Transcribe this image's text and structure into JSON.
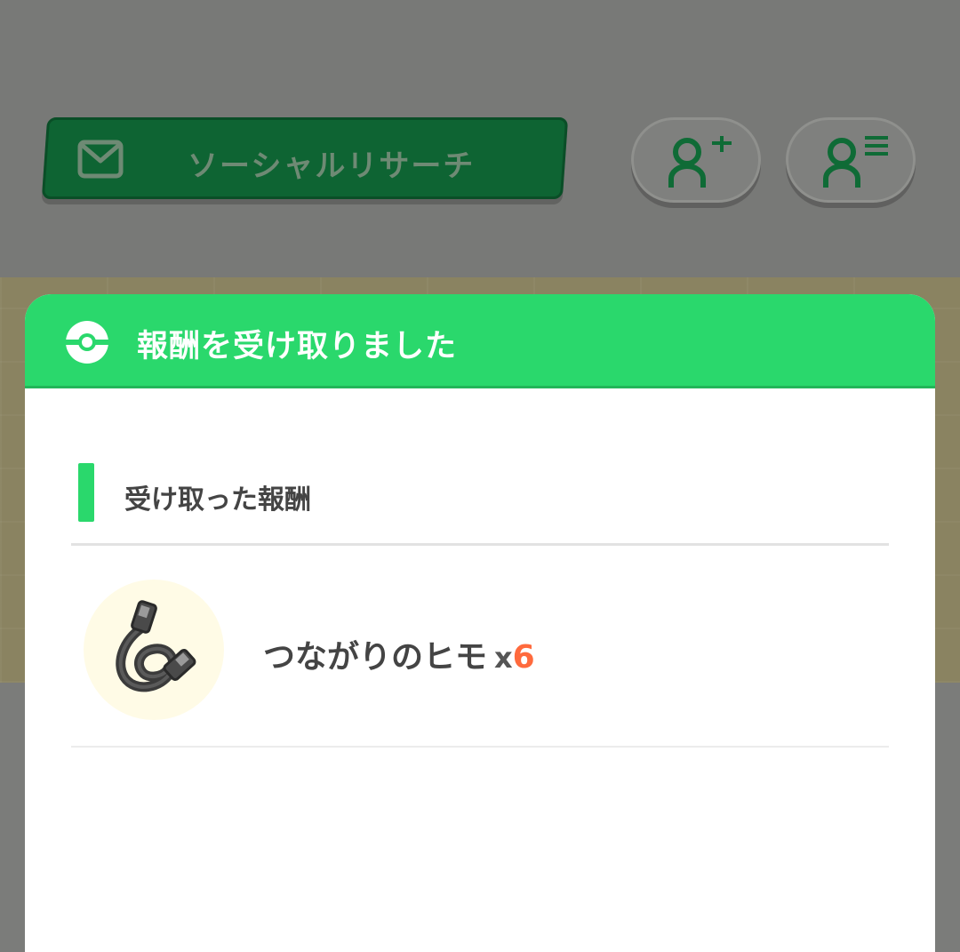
{
  "background": {
    "research_button": {
      "label": "ソーシャルリサーチ",
      "icon": "mail-icon"
    },
    "add_friend_button": {
      "icon": "add-person-icon"
    },
    "friend_list_button": {
      "icon": "person-list-icon"
    }
  },
  "modal": {
    "title": "報酬を受け取りました",
    "title_icon": "pokeball-icon",
    "section_title": "受け取った報酬",
    "reward": {
      "name": "つながりのヒモ",
      "multiplier": "x",
      "count": "6",
      "icon": "link-cable-icon"
    }
  },
  "colors": {
    "header_green": "#2ad86c",
    "count_orange": "#ff6a3d",
    "research_green": "#0e6433"
  }
}
